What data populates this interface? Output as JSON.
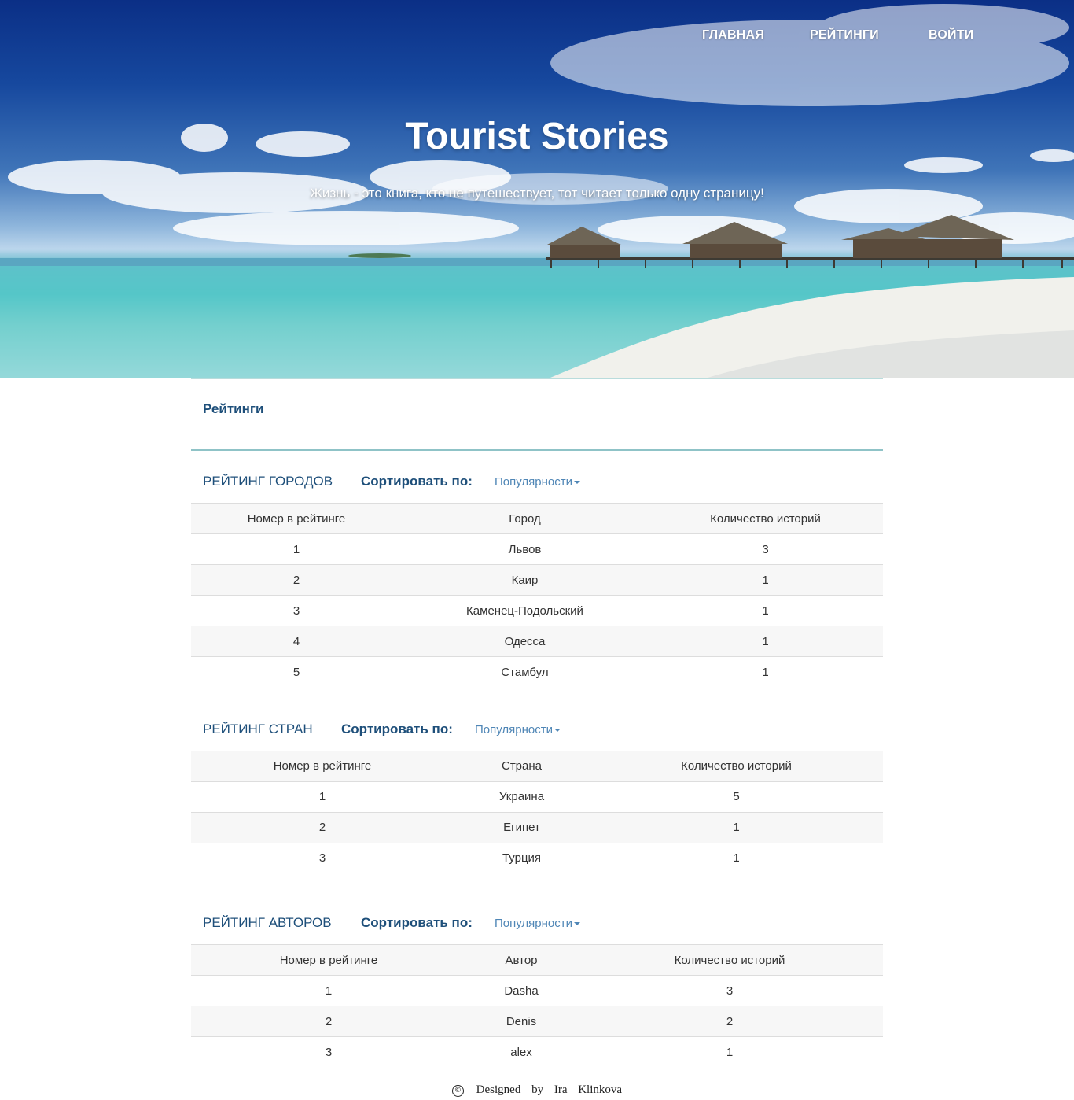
{
  "nav": {
    "home": "ГЛАВНАЯ",
    "ratings": "РЕЙТИНГИ",
    "login": "ВОЙТИ"
  },
  "hero": {
    "title": "Tourist Stories",
    "subtitle": "Жизнь - это книга, кто не путешествует, тот читает только одну страницу!"
  },
  "page": {
    "heading": "Рейтинги"
  },
  "sections": {
    "cities": {
      "title": "РЕЙТИНГ ГОРОДОВ",
      "sort_label": "Сортировать по:",
      "sort_value": "Популярности",
      "columns": [
        "Номер в рейтинге",
        "Город",
        "Количество историй"
      ],
      "rows": [
        [
          "1",
          "Львов",
          "3"
        ],
        [
          "2",
          "Каир",
          "1"
        ],
        [
          "3",
          "Каменец-Подольский",
          "1"
        ],
        [
          "4",
          "Одесса",
          "1"
        ],
        [
          "5",
          "Стамбул",
          "1"
        ]
      ]
    },
    "countries": {
      "title": "РЕЙТИНГ СТРАН",
      "sort_label": "Сортировать по:",
      "sort_value": "Популярности",
      "columns": [
        "Номер в рейтинге",
        "Страна",
        "Количество историй"
      ],
      "rows": [
        [
          "1",
          "Украина",
          "5"
        ],
        [
          "2",
          "Египет",
          "1"
        ],
        [
          "3",
          "Турция",
          "1"
        ]
      ]
    },
    "authors": {
      "title": "РЕЙТИНГ АВТОРОВ",
      "sort_label": "Сортировать по:",
      "sort_value": "Популярности",
      "columns": [
        "Номер в рейтинге",
        "Автор",
        "Количество историй"
      ],
      "rows": [
        [
          "1",
          "Dasha",
          "3"
        ],
        [
          "2",
          "Denis",
          "2"
        ],
        [
          "3",
          "alex",
          "1"
        ]
      ]
    }
  },
  "footer": {
    "copyright_icon": "©",
    "text": "Designed by Ira Klinkova"
  },
  "colors": {
    "accent": "#1e4f7a",
    "link": "#4f86b6",
    "divider": "#8fc3c7"
  }
}
